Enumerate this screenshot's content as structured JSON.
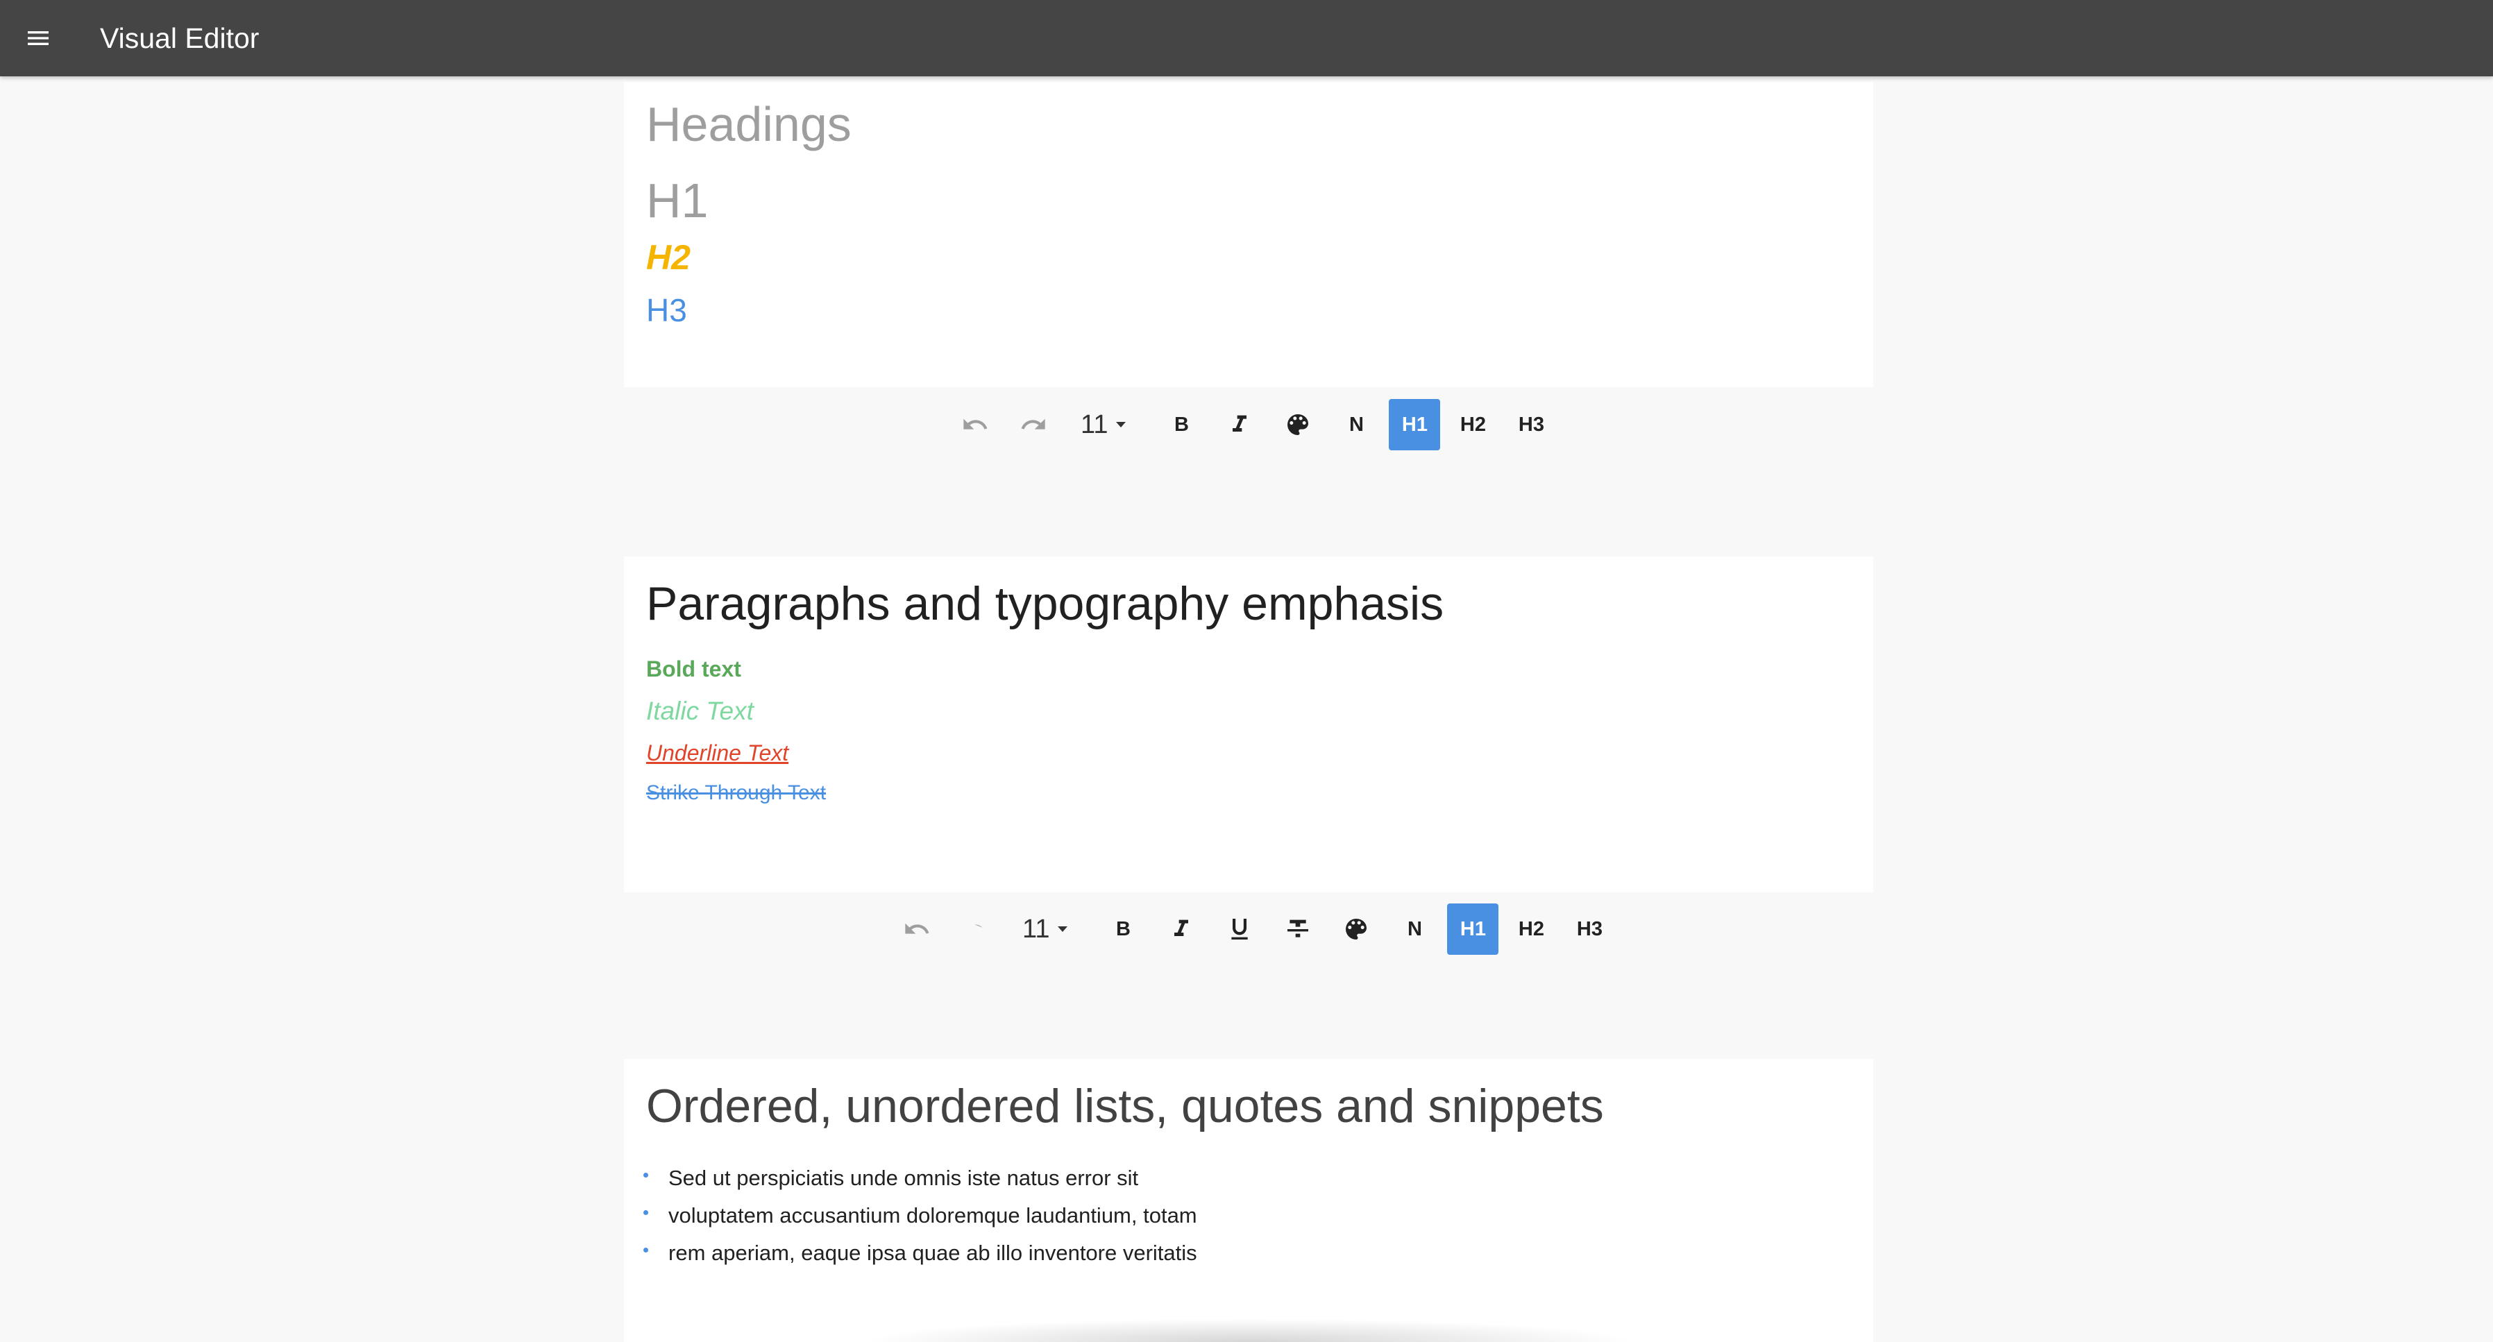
{
  "app": {
    "title": "Visual Editor"
  },
  "section1": {
    "title": "Headings",
    "h1": "H1",
    "h2": "H2",
    "h3": "H3"
  },
  "toolbar1": {
    "font_size": "11",
    "bold": "B",
    "normal": "N",
    "h1": "H1",
    "h2": "H2",
    "h3": "H3",
    "active": "H1"
  },
  "section2": {
    "title": "Paragraphs and typography emphasis",
    "bold": "Bold text",
    "italic": "Italic Text",
    "underline": "Underline Text",
    "strike": "Strike Through Text"
  },
  "toolbar2": {
    "font_size": "11",
    "bold": "B",
    "normal": "N",
    "h1": "H1",
    "h2": "H2",
    "h3": "H3",
    "active": "H1"
  },
  "section3": {
    "title": "Ordered, unordered lists, quotes and snippets",
    "items": [
      "Sed ut perspiciatis unde omnis iste natus error sit",
      "voluptatem accusantium doloremque laudantium, totam",
      "rem aperiam, eaque ipsa quae ab illo inventore veritatis"
    ]
  },
  "colors": {
    "appbar": "#454545",
    "accent": "#4a90e2",
    "h2": "#f4b400",
    "bold_text": "#5aa85a",
    "italic_text": "#7ed8a0",
    "underline_text": "#e0452a"
  },
  "icons": [
    "menu-icon",
    "undo-icon",
    "redo-icon",
    "italic-icon",
    "underline-icon",
    "strikethrough-icon",
    "palette-icon"
  ]
}
